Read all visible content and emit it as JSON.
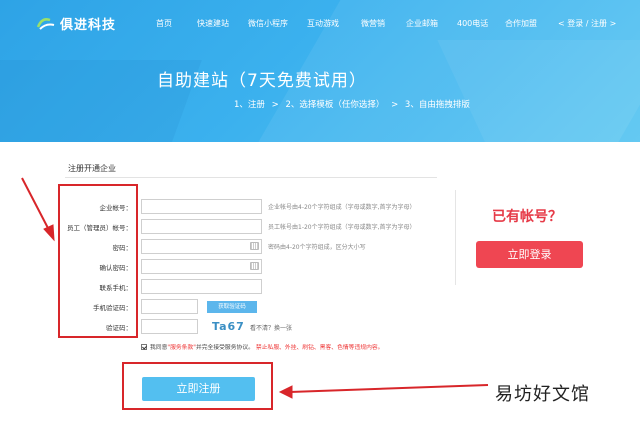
{
  "brand": {
    "name": "俱进科技"
  },
  "nav": {
    "items": [
      "首页",
      "快速建站",
      "微信小程序",
      "互动游戏",
      "微营销",
      "企业邮箱",
      "400电话",
      "合作加盟"
    ],
    "login_register": "< 登录 / 注册 >"
  },
  "hero": {
    "title": "自助建站（7天免费试用）",
    "steps": [
      "1、注册",
      ">",
      "2、选择模板（任你选择）",
      ">",
      "3、自由拖拽排版"
    ]
  },
  "form": {
    "section_title": "注册开通企业",
    "fields": [
      {
        "label": "企业帐号：",
        "hint": "企业帐号由4-20个字符组成（字母或数字,首字为字母）"
      },
      {
        "label": "员工（管理员）帐号：",
        "hint": "员工帐号由1-20个字符组成（字母或数字,首字为字母）"
      },
      {
        "label": "密码：",
        "hint": "密码由4-20个字符组成，区分大小写"
      },
      {
        "label": "确认密码：",
        "hint": ""
      },
      {
        "label": "联系手机：",
        "hint": ""
      },
      {
        "label": "手机验证码：",
        "hint": ""
      },
      {
        "label": "验证码：",
        "hint": ""
      }
    ],
    "sms_button": "获取验证码",
    "captcha_text": "Ta67",
    "captcha_refresh": "看不清？换一张",
    "agree": {
      "prefix": "我同意",
      "terms": "\"服务条款\"",
      "middle": "并完全接受服务协议。",
      "warning": "禁止私服、外挂、刷钻、黑客、色情等违规内容。"
    },
    "submit_label": "立即注册"
  },
  "side": {
    "has_account": "已有帐号？",
    "login_button": "立即登录"
  },
  "watermark": "易坊好文馆",
  "colors": {
    "hero_blue": "#3bb1ee",
    "submit_blue": "#53bff0",
    "login_red": "#ef4652",
    "annotation_red": "#d8262a"
  }
}
